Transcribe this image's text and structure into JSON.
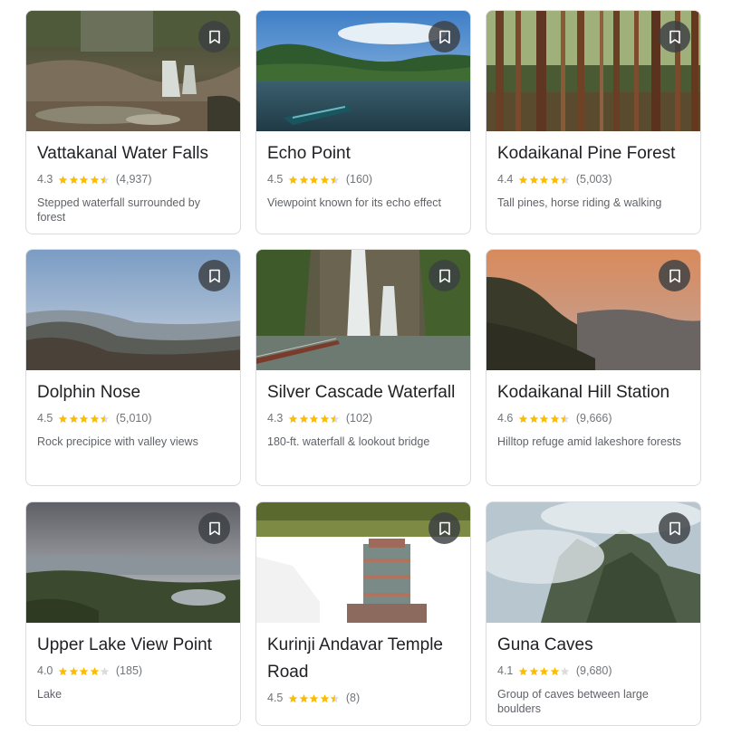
{
  "places": [
    {
      "name": "Vattakanal Water Falls",
      "rating": "4.3",
      "stars": 4.3,
      "reviews": "(4,937)",
      "description": "Stepped waterfall surrounded by forest",
      "image": "waterfall-stream-photo"
    },
    {
      "name": "Echo Point",
      "rating": "4.5",
      "stars": 4.5,
      "reviews": "(160)",
      "description": "Viewpoint known for its echo effect",
      "image": "lake-boat-photo"
    },
    {
      "name": "Kodaikanal Pine Forest",
      "rating": "4.4",
      "stars": 4.4,
      "reviews": "(5,003)",
      "description": "Tall pines, horse riding & walking",
      "image": "pine-forest-photo"
    },
    {
      "name": "Dolphin Nose",
      "rating": "4.5",
      "stars": 4.5,
      "reviews": "(5,010)",
      "description": "Rock precipice with valley views",
      "image": "mountain-valley-photo"
    },
    {
      "name": "Silver Cascade Waterfall",
      "rating": "4.3",
      "stars": 4.3,
      "reviews": "(102)",
      "description": "180-ft. waterfall & lookout bridge",
      "image": "cascade-bridge-photo"
    },
    {
      "name": "Kodaikanal Hill Station",
      "rating": "4.6",
      "stars": 4.6,
      "reviews": "(9,666)",
      "description": "Hilltop refuge amid lakeshore forests",
      "image": "sunset-hills-photo"
    },
    {
      "name": "Upper Lake View Point",
      "rating": "4.0",
      "stars": 4.0,
      "reviews": "(185)",
      "description": "Lake",
      "image": "lake-town-photo"
    },
    {
      "name": "Kurinji Andavar Temple Road",
      "rating": "4.5",
      "stars": 4.5,
      "reviews": "(8)",
      "description": "",
      "image": "temple-gopuram-photo"
    },
    {
      "name": "Guna Caves",
      "rating": "4.1",
      "stars": 4.1,
      "reviews": "(9,680)",
      "description": "Group of caves between large boulders",
      "image": "misty-cliffs-photo"
    }
  ],
  "colors": {
    "star_filled": "#fbbc04",
    "star_empty": "#dadce0",
    "bookmark_bg": "#3c4043",
    "border": "#dadce0"
  }
}
